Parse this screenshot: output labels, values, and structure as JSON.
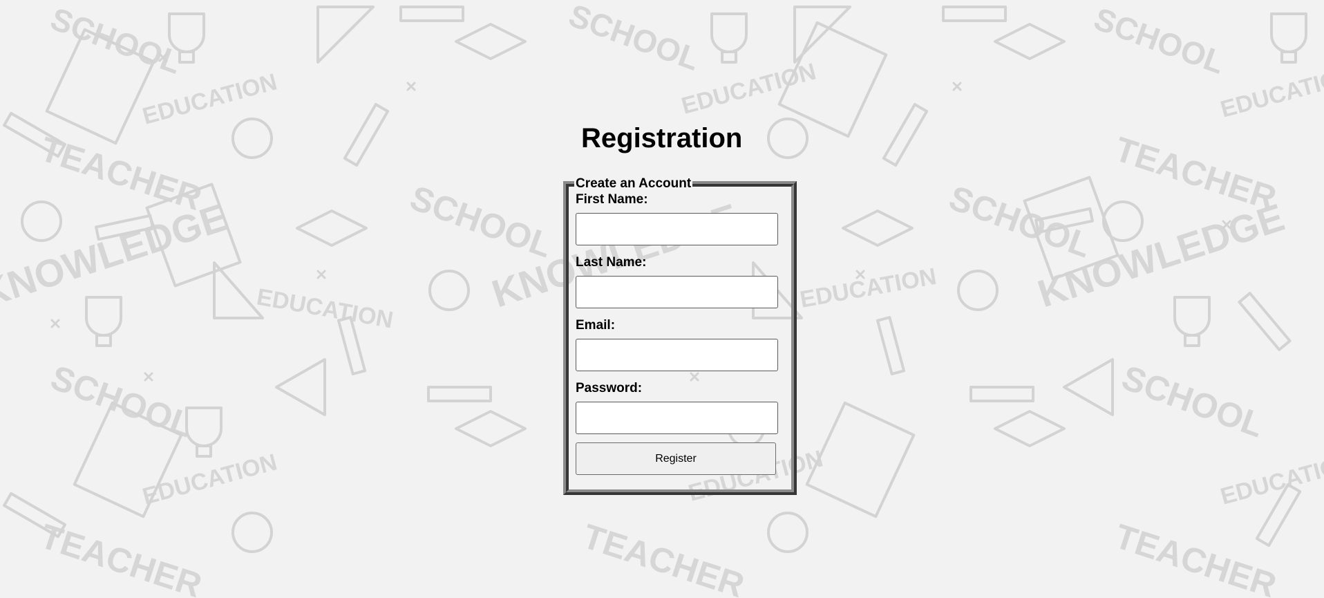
{
  "page": {
    "title": "Registration"
  },
  "background": {
    "words": [
      "SCHOOL",
      "EDUCATION",
      "TEACHER",
      "KNOWLEDGE"
    ],
    "color": "#d3d3d3"
  },
  "form": {
    "legend": "Create an Account",
    "fields": [
      {
        "label": "First Name:",
        "value": "",
        "placeholder": ""
      },
      {
        "label": "Last Name:",
        "value": "",
        "placeholder": ""
      },
      {
        "label": "Email:",
        "value": "",
        "placeholder": ""
      },
      {
        "label": "Password:",
        "value": "",
        "placeholder": ""
      }
    ],
    "submit_label": "Register"
  }
}
